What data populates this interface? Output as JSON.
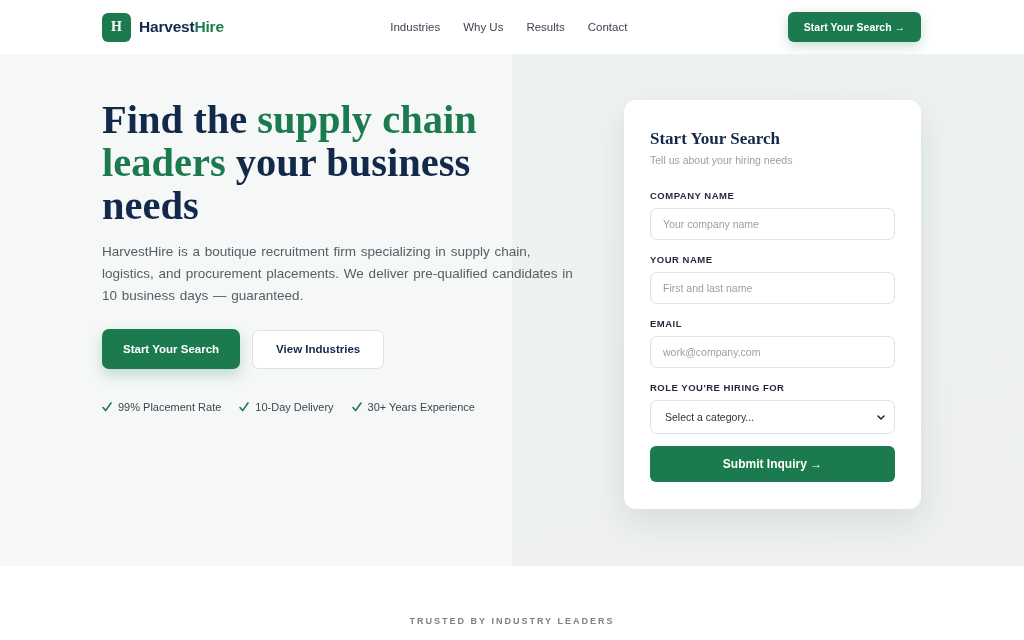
{
  "header": {
    "logo": {
      "letter": "H",
      "name_start": "Harvest",
      "name_end": "Hire"
    },
    "nav": [
      "Industries",
      "Why Us",
      "Results",
      "Contact"
    ],
    "cta": "Start Your Search →"
  },
  "hero": {
    "heading": [
      {
        "text": "Find the ",
        "accent": false
      },
      {
        "text": "supply chain leaders",
        "accent": true
      },
      {
        "text": " your business needs",
        "accent": false
      }
    ],
    "description": "HarvestHire is a boutique recruitment firm specializing in supply chain, logistics, and procurement placements. We deliver pre-qualified candidates in 10 business days — guaranteed.",
    "buttons": [
      {
        "label": "Start Your Search",
        "kind": "primary"
      },
      {
        "label": "View Industries",
        "kind": "secondary"
      }
    ],
    "highlights": [
      "99% Placement Rate",
      "10-Day Delivery",
      "30+ Years Experience"
    ]
  },
  "form": {
    "title": "Start Your Search",
    "subtitle": "Tell us about your hiring needs",
    "fields": [
      {
        "label": "COMPANY NAME",
        "kind": "text",
        "placeholder": "Your company name"
      },
      {
        "label": "YOUR NAME",
        "kind": "text",
        "placeholder": "First and last name"
      },
      {
        "label": "EMAIL",
        "kind": "text",
        "placeholder": "work@company.com"
      },
      {
        "label": "ROLE YOU'RE HIRING FOR",
        "kind": "select",
        "value": "Select a category..."
      }
    ],
    "submit": "Submit Inquiry →"
  },
  "trusted": {
    "title": "TRUSTED BY INDUSTRY LEADERS"
  }
}
